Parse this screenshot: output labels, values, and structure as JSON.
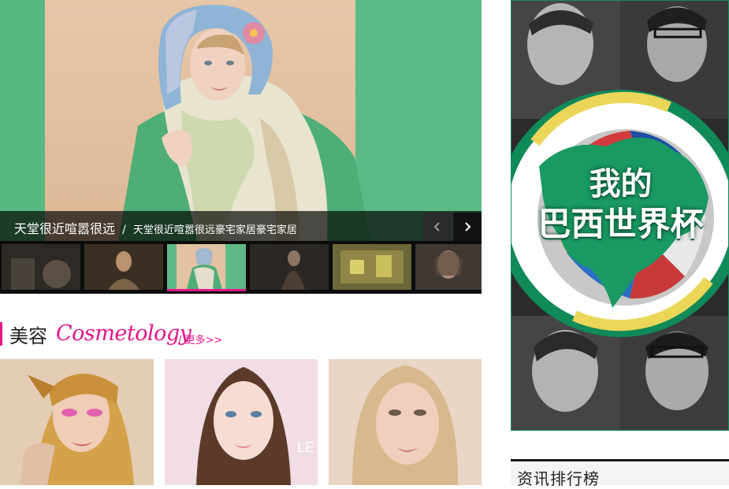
{
  "slider": {
    "title": "天堂很近喧嚣很远",
    "separator": "/",
    "subtitle": "天堂很近喧嚣很远豪宅家居豪宅家居",
    "prev_icon": "chevron-left-icon",
    "next_icon": "chevron-right-icon",
    "active_thumb_index": 2,
    "accent_color": "#e4168a"
  },
  "section": {
    "title_cn": "美容",
    "title_en": "Cosmetology",
    "more_label": "/ 更多>>",
    "accent_color": "#e4168a"
  },
  "cards": [
    {
      "watermark": ""
    },
    {
      "watermark": "LE"
    },
    {
      "watermark": ""
    }
  ],
  "ad": {
    "line1": "我的",
    "line2": "巴西世界杯",
    "accent_color": "#0f8a58"
  },
  "ranking": {
    "title": "资讯排行榜"
  }
}
